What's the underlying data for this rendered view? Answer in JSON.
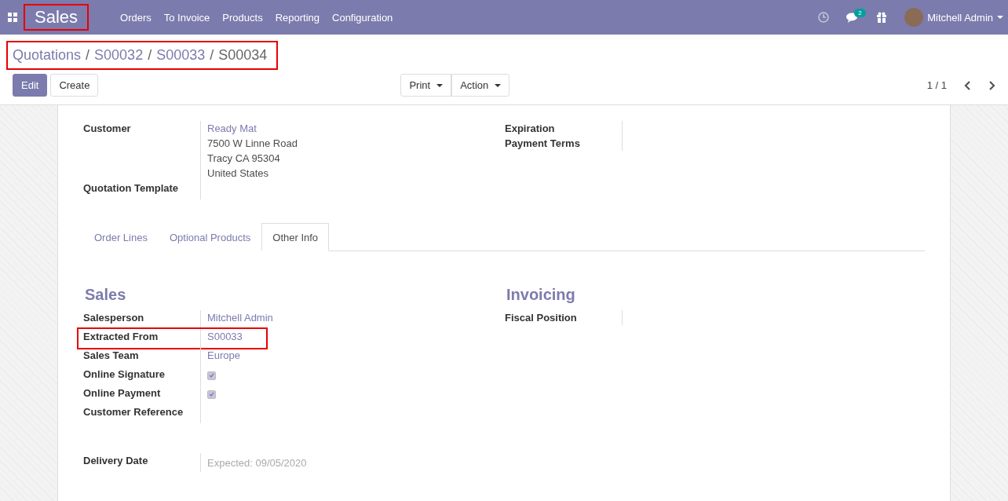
{
  "navbar": {
    "app_name": "Sales",
    "app_name_highlighted": true,
    "menu": [
      "Orders",
      "To Invoice",
      "Products",
      "Reporting",
      "Configuration"
    ],
    "message_count": "2",
    "user": "Mitchell Admin"
  },
  "breadcrumb": {
    "highlighted": true,
    "separator": "/",
    "items": [
      {
        "label": "Quotations",
        "current": false
      },
      {
        "label": "S00032",
        "current": false
      },
      {
        "label": "S00033",
        "current": false
      },
      {
        "label": "S00034",
        "current": true
      }
    ]
  },
  "buttons": {
    "edit": "Edit",
    "create": "Create",
    "print": "Print",
    "action": "Action"
  },
  "pager": "1 / 1",
  "header_left": [
    {
      "label": "Customer",
      "lines": [
        {
          "text": "Ready Mat",
          "kind": "link"
        },
        {
          "text": "7500 W Linne Road",
          "kind": "text"
        },
        {
          "text": "Tracy CA 95304",
          "kind": "text"
        },
        {
          "text": "United States",
          "kind": "text"
        }
      ]
    },
    {
      "label": "Quotation Template"
    }
  ],
  "header_right": [
    {
      "label": "Expiration"
    },
    {
      "label": "Payment Terms"
    }
  ],
  "tabs": [
    {
      "label": "Order Lines",
      "selected": false
    },
    {
      "label": "Optional Products",
      "selected": false
    },
    {
      "label": "Other Info",
      "selected": true
    }
  ],
  "sales": {
    "title": "Sales",
    "fields": [
      {
        "label": "Salesperson",
        "kind": "link",
        "value": "Mitchell Admin",
        "highlighted": false
      },
      {
        "label": "Extracted From",
        "kind": "link",
        "value": "S00033",
        "highlighted": true
      },
      {
        "label": "Sales Team",
        "kind": "link",
        "value": "Europe",
        "highlighted": false
      },
      {
        "label": "Online Signature",
        "kind": "checkbox",
        "checked": true,
        "highlighted": false
      },
      {
        "label": "Online Payment",
        "kind": "checkbox",
        "checked": true,
        "highlighted": false
      },
      {
        "label": "Customer Reference",
        "kind": "empty",
        "highlighted": false
      }
    ]
  },
  "invoicing": {
    "title": "Invoicing",
    "fields": [
      {
        "label": "Fiscal Position"
      }
    ]
  },
  "delivery": {
    "label": "Delivery Date",
    "placeholder": "Expected: 09/05/2020"
  }
}
